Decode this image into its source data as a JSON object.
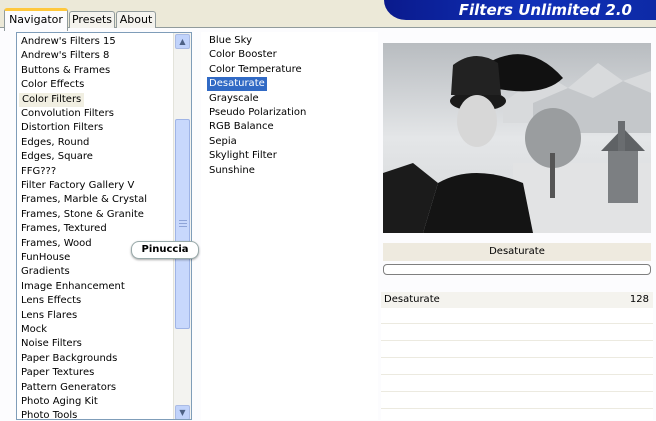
{
  "tabs": [
    {
      "label": "Navigator",
      "active": true
    },
    {
      "label": "Presets",
      "active": false
    },
    {
      "label": "About",
      "active": false
    }
  ],
  "app_title": "Filters Unlimited 2.0",
  "categories": {
    "items": [
      "Andrew's Filters 15",
      "Andrew's Filters 8",
      "Buttons & Frames",
      "Color Effects",
      "Color Filters",
      "Convolution Filters",
      "Distortion Filters",
      "Edges, Round",
      "Edges, Square",
      "FFG???",
      "Filter Factory Gallery V",
      "Frames, Marble & Crystal",
      "Frames, Stone & Granite",
      "Frames, Textured",
      "Frames, Wood",
      "FunHouse",
      "Gradients",
      "Image Enhancement",
      "Lens Effects",
      "Lens Flares",
      "Mock",
      "Noise Filters",
      "Paper Backgrounds",
      "Paper Textures",
      "Pattern Generators",
      "Photo Aging Kit",
      "Photo Tools"
    ],
    "selected": "Color Filters"
  },
  "filters": {
    "items": [
      "Blue Sky",
      "Color Booster",
      "Color Temperature",
      "Desaturate",
      "Grayscale",
      "Pseudo Polarization",
      "RGB Balance",
      "Sepia",
      "Skylight Filter",
      "Sunshine"
    ],
    "selected": "Desaturate"
  },
  "watermark": "Pinuccia",
  "preview": {
    "filter_name": "Desaturate",
    "progress": 0
  },
  "controls": [
    {
      "label": "Desaturate",
      "value": "128"
    }
  ],
  "icons": {
    "scroll_up": "chevron-up-icon",
    "scroll_down": "chevron-down-icon"
  }
}
